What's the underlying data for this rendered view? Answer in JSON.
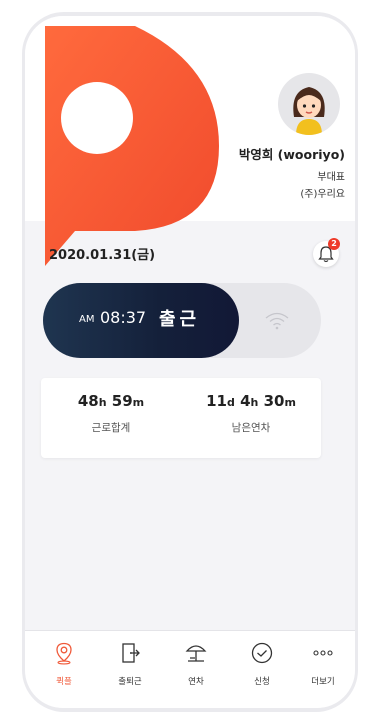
{
  "profile": {
    "name": "박영희 (wooriyo)",
    "role": "부대표",
    "company": "(주)우리요"
  },
  "date": "2020.01.31(금)",
  "notifications": {
    "count": "2"
  },
  "clock": {
    "ampm": "AM",
    "time": "08:37",
    "status_label": "출근",
    "status_on": true
  },
  "stats": [
    {
      "d": "48",
      "du": "h",
      "m": "59",
      "mu": "m",
      "label": "근로합계"
    },
    {
      "d": "11",
      "du": "d",
      "m": "4",
      "mu": "h",
      "s": "30",
      "su": "m",
      "label": "남은연차"
    }
  ],
  "tabs": [
    {
      "label": "퀵플",
      "icon": "location-pin-icon",
      "active": true
    },
    {
      "label": "출퇴근",
      "icon": "door-exit-icon",
      "active": false
    },
    {
      "label": "연차",
      "icon": "beach-umbrella-icon",
      "active": false
    },
    {
      "label": "신청",
      "icon": "check-circle-icon",
      "active": false
    },
    {
      "label": "더보기",
      "icon": "more-dots-icon",
      "active": false
    }
  ],
  "colors": {
    "brand": "#f05a3a",
    "dark": "#14203a"
  }
}
